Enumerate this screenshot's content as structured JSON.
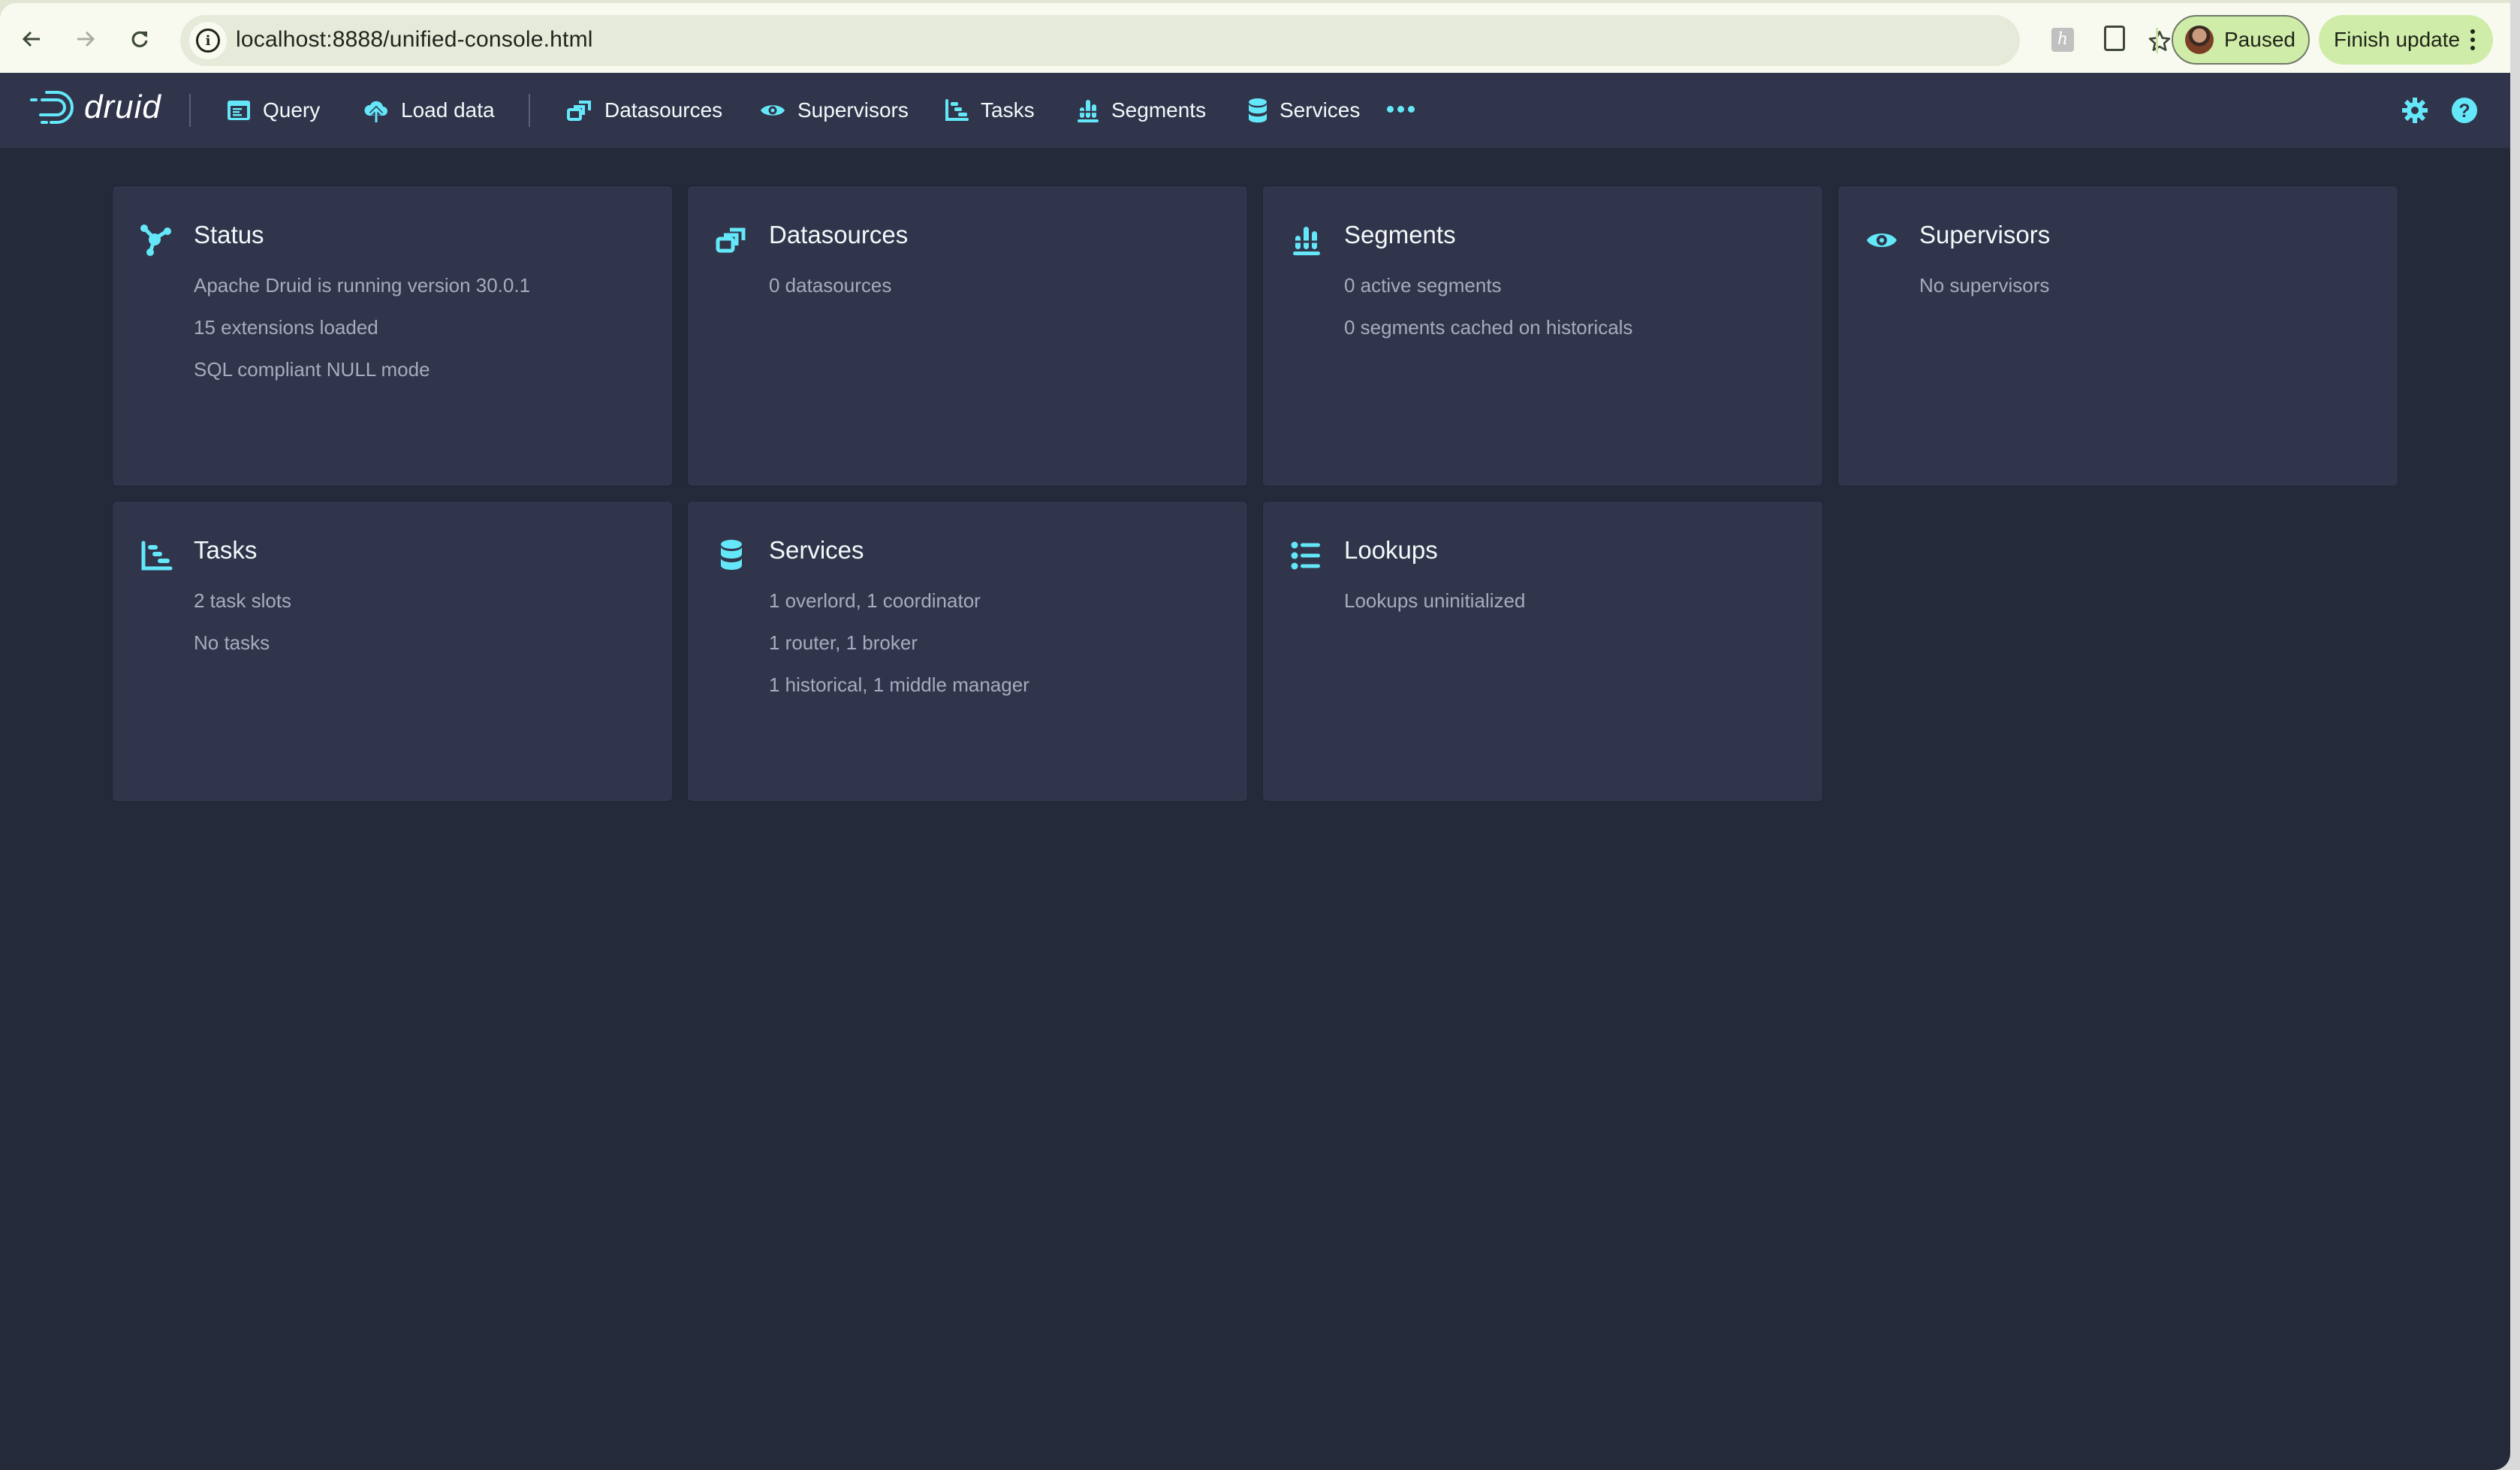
{
  "browser": {
    "url": "localhost:8888/unified-console.html",
    "back_icon": "arrow-left-icon",
    "forward_icon": "arrow-right-icon",
    "reload_icon": "reload-icon",
    "info_icon": "info-icon",
    "bookmark_icon": "star-icon",
    "profile_status": "Paused",
    "update_label": "Finish update",
    "extension_h_label": "h"
  },
  "navbar": {
    "logo_text": "druid",
    "items": [
      {
        "label": "Query",
        "icon": "application-icon"
      },
      {
        "label": "Load data",
        "icon": "cloud-upload-icon"
      },
      {
        "label": "Datasources",
        "icon": "multi-select-icon"
      },
      {
        "label": "Supervisors",
        "icon": "eye-icon"
      },
      {
        "label": "Tasks",
        "icon": "gantt-chart-icon"
      },
      {
        "label": "Segments",
        "icon": "stacked-chart-icon"
      },
      {
        "label": "Services",
        "icon": "database-icon"
      }
    ],
    "more_icon": "more-icon",
    "settings_icon": "cog-icon",
    "help_icon": "help-icon"
  },
  "colors": {
    "accent": "#64e8f9",
    "navbar_bg": "#30354b",
    "page_bg": "#252a3a",
    "card_bg": "#30354b",
    "card_title": "#f5f8fa",
    "card_text": "#a7abbf",
    "chrome_bg": "#f8faf0",
    "chrome_pill": "#cfeca8"
  },
  "cards": [
    {
      "title": "Status",
      "icon": "graph-icon",
      "lines": [
        "Apache Druid is running version 30.0.1",
        "15 extensions loaded",
        "SQL compliant NULL mode"
      ]
    },
    {
      "title": "Datasources",
      "icon": "multi-select-icon",
      "lines": [
        "0 datasources"
      ]
    },
    {
      "title": "Segments",
      "icon": "stacked-chart-icon",
      "lines": [
        "0 active segments",
        "0 segments cached on historicals"
      ]
    },
    {
      "title": "Supervisors",
      "icon": "eye-icon",
      "lines": [
        "No supervisors"
      ]
    },
    {
      "title": "Tasks",
      "icon": "gantt-chart-icon",
      "lines": [
        "2 task slots",
        "No tasks"
      ]
    },
    {
      "title": "Services",
      "icon": "database-icon",
      "lines": [
        "1 overlord, 1 coordinator",
        "1 router, 1 broker",
        "1 historical, 1 middle manager"
      ]
    },
    {
      "title": "Lookups",
      "icon": "properties-icon",
      "lines": [
        "Lookups uninitialized"
      ]
    }
  ]
}
